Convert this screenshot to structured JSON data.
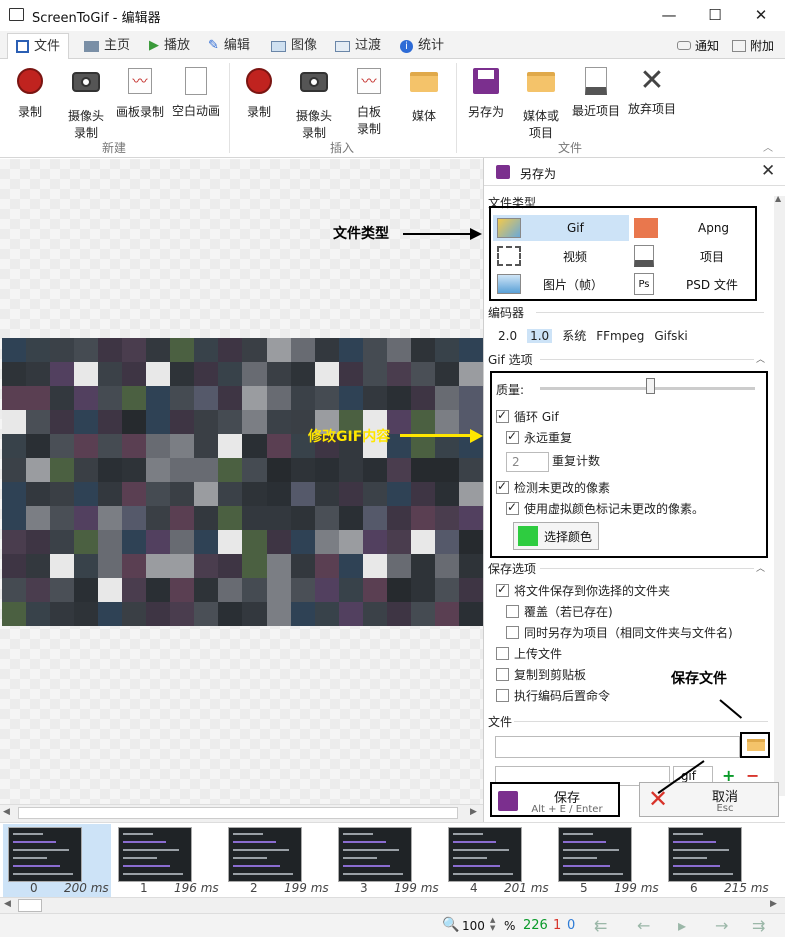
{
  "window": {
    "title": "ScreenToGif - 编辑器",
    "min": "—",
    "max": "☐",
    "close": "✕"
  },
  "tabs": [
    {
      "label": "文件",
      "icon": "save-icon",
      "active": true
    },
    {
      "label": "主页",
      "icon": "home-icon"
    },
    {
      "label": "播放",
      "icon": "play-icon"
    },
    {
      "label": "编辑",
      "icon": "pencil-icon"
    },
    {
      "label": "图像",
      "icon": "image-icon"
    },
    {
      "label": "过渡",
      "icon": "transition-icon"
    },
    {
      "label": "统计",
      "icon": "info-icon"
    }
  ],
  "tabs_right": {
    "notify": "通知",
    "attach": "附加"
  },
  "ribbon": {
    "new_group": "新建",
    "insert_group": "插入",
    "file_group": "文件",
    "buttons_new": [
      {
        "l1": "录制",
        "l2": ""
      },
      {
        "l1": "摄像头",
        "l2": "录制"
      },
      {
        "l1": "画板录制",
        "l2": ""
      },
      {
        "l1": "空白动画",
        "l2": ""
      }
    ],
    "buttons_insert": [
      {
        "l1": "录制",
        "l2": ""
      },
      {
        "l1": "摄像头",
        "l2": "录制"
      },
      {
        "l1": "白板",
        "l2": "录制"
      },
      {
        "l1": "媒体",
        "l2": ""
      }
    ],
    "buttons_file": [
      {
        "l1": "另存为",
        "l2": ""
      },
      {
        "l1": "媒体或",
        "l2": "项目"
      },
      {
        "l1": "最近项目",
        "l2": ""
      },
      {
        "l1": "放弃项目",
        "l2": ""
      }
    ]
  },
  "panel": {
    "title": "另存为",
    "file_type_label": "文件类型",
    "file_types": [
      [
        "Gif",
        "Apng"
      ],
      [
        "视频",
        "项目"
      ],
      [
        "图片（帧）",
        "PSD 文件"
      ]
    ],
    "encoder_label": "编码器",
    "encoders": [
      "2.0",
      "1.0",
      "系统",
      "FFmpeg",
      "Gifski"
    ],
    "gif_options_label": "Gif 选项",
    "quality_label": "质量:",
    "quality_value": 0.51,
    "loop_gif": "循环 Gif",
    "loop_forever": "永远重复",
    "repeat_count_value": "2",
    "repeat_count_label": "重复计数",
    "detect_unchanged": "检测未更改的像素",
    "dummy_color": "使用虚拟颜色标记未更改的像素。",
    "choose_color": "选择颜色",
    "chosen_color": "#2ecc40",
    "save_options_label": "保存选项",
    "save_to_folder": "将文件保存到你选择的文件夹",
    "overwrite": "覆盖（若已存在)",
    "save_as_project": "同时另存为项目（相同文件夹与文件名)",
    "upload": "上传文件",
    "copy_clipboard": "复制到剪贴板",
    "post_encode": "执行编码后置命令",
    "file_label": "文件",
    "ext_value": ".gif",
    "save_button": "保存",
    "save_shortcut": "Alt + E / Enter",
    "cancel_button": "取消",
    "cancel_shortcut": "Esc"
  },
  "annotations": {
    "file_type": "文件类型",
    "modify_gif": "修改GIF内容",
    "save_file": "保存文件"
  },
  "frames": [
    {
      "n": "0",
      "ms": "200 ms"
    },
    {
      "n": "1",
      "ms": "196 ms"
    },
    {
      "n": "2",
      "ms": "199 ms"
    },
    {
      "n": "3",
      "ms": "199 ms"
    },
    {
      "n": "4",
      "ms": "201 ms"
    },
    {
      "n": "5",
      "ms": "199 ms"
    },
    {
      "n": "6",
      "ms": "215 ms"
    }
  ],
  "status": {
    "zoom": "100",
    "percent": "%",
    "total": "226",
    "selected": "1",
    "current": "0"
  },
  "colors": {
    "accent": "#cde3f7",
    "green": "#0a9a2a",
    "red": "#d8332a",
    "blue": "#2d7bd6"
  }
}
